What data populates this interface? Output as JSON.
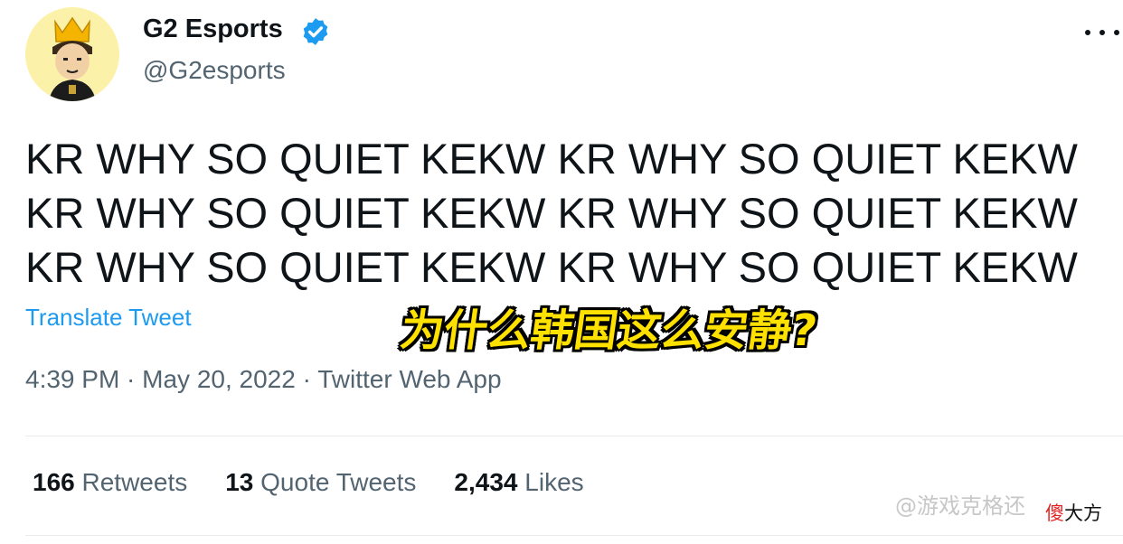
{
  "author": {
    "display_name": "G2 Esports",
    "handle": "@G2esports",
    "verified_icon": "verified-badge-icon",
    "avatar_icon": "cartoon-king-avatar"
  },
  "tweet": {
    "lines": [
      "KR WHY SO QUIET KEKW KR WHY SO QUIET KEKW",
      "KR WHY SO QUIET KEKW KR WHY SO QUIET KEKW",
      "KR WHY SO QUIET KEKW KR WHY SO QUIET KEKW"
    ],
    "translate_label": "Translate Tweet",
    "timestamp": "4:39 PM · May 20, 2022 · Twitter Web App"
  },
  "overlay_subtitle": "为什么韩国这么安静?",
  "stats": {
    "retweets_count": "166",
    "retweets_label": "Retweets",
    "quotes_count": "13",
    "quotes_label": "Quote Tweets",
    "likes_count": "2,434",
    "likes_label": "Likes"
  },
  "watermark": {
    "text": "@游戏克格还",
    "brand_red": "傻",
    "brand_dark": "大方"
  },
  "colors": {
    "link": "#1d9bf0",
    "secondary_text": "#536471",
    "subtitle_yellow": "#ffe100",
    "avatar_bg": "#fbf1a8"
  }
}
